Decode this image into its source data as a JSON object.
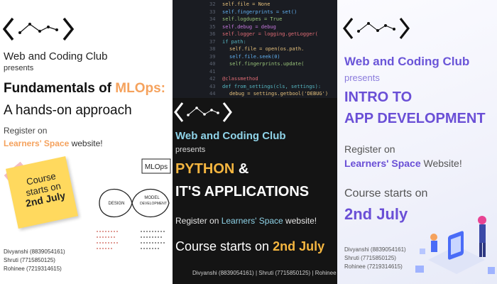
{
  "colors": {
    "mlops_accent": "#f5a25d",
    "python_accent": "#f5b640",
    "cyan_accent": "#8fd3e8",
    "purple_accent": "#6a4fd6"
  },
  "panel1": {
    "club": "Web and Coding Club",
    "presents": "presents",
    "title_prefix": "Fundamentals of ",
    "title_accent": "MLOps:",
    "title_line2": "A hands-on approach",
    "register_line1": "Register on",
    "register_accent": "Learners' Space",
    "register_suffix": " website!",
    "sticky_line1": "Course",
    "sticky_line2": "starts on",
    "sticky_line3": "2nd July",
    "diagram": {
      "label_mlops": "MLOps",
      "label_design": "DESIGN",
      "label_model": "MODEL",
      "label_dev": "DEVELOPMENT"
    },
    "contacts": [
      "Divyanshi (8839054161)",
      "Shruti (7715850125)",
      "Rohinee (7219314615)"
    ]
  },
  "panel2": {
    "club": "Web and Coding Club",
    "presents": "presents",
    "title_accent": "PYTHON",
    "title_suffix": " &",
    "title_line2": "IT'S APPLICATIONS",
    "register_prefix": "Register on ",
    "register_accent": "Learners' Space",
    "register_suffix": " website!",
    "starts_prefix": "Course starts on ",
    "starts_accent": "2nd July",
    "contacts": "Divyanshi (8839054161) | Shruti (7715850125) | Rohinee (7",
    "code_lines": [
      "self.file = None",
      "self.fingerprints = set()",
      "self.logdupes = True",
      "self.debug = debug",
      "self.logger = logging.getLogger(",
      "if path:",
      "    self.file = open(os.path.",
      "    self.file.seek(0)",
      "    self.fingerprints.update(",
      "",
      "@classmethod",
      "def from_settings(cls, settings):",
      "    debug = settings.getbool('DEBUG')"
    ],
    "line_numbers": [
      "32",
      "33",
      "34",
      "35",
      "36",
      "37",
      "38",
      "39",
      "40",
      "41",
      "42",
      "43",
      "44"
    ]
  },
  "panel3": {
    "club": "Web and Coding Club",
    "presents": "presents",
    "title_line1": "INTRO TO",
    "title_line2": "APP DEVELOPMENT",
    "register_line1": "Register on",
    "register_accent": "Learners' Space",
    "register_suffix": " Website!",
    "starts_line1": "Course starts on",
    "starts_line2": "2nd July",
    "contacts": [
      "Divyanshi (8839054161)",
      "Shruti (7715850125)",
      "Rohinee (7219314615)"
    ]
  }
}
